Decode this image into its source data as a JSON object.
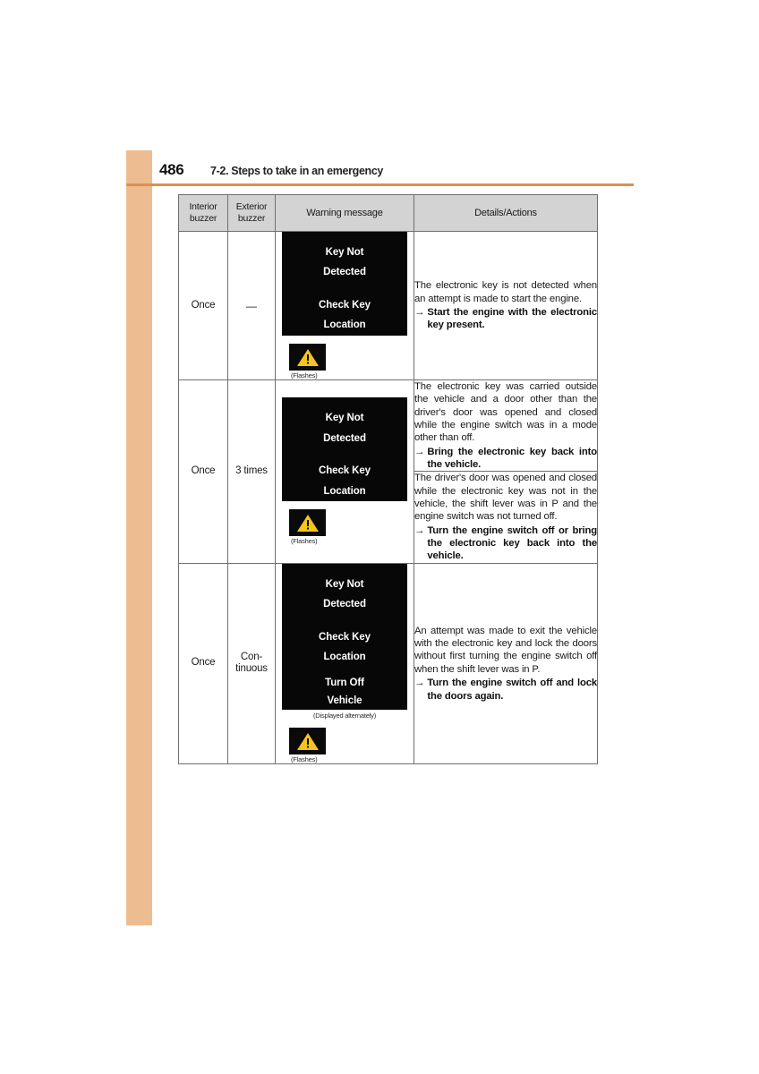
{
  "header": {
    "page_number": "486",
    "section_title": "7-2. Steps to take in an emergency"
  },
  "colors": {
    "side_tab": "#edbc91",
    "header_rule": "#de8f4f",
    "table_header_fill": "#d3d3d3",
    "display_panel_bg": "#070707",
    "warning_triangle": "#f5c518"
  },
  "table": {
    "columns": [
      {
        "line1": "Interior",
        "line2": "buzzer"
      },
      {
        "line1": "Exterior",
        "line2": "buzzer"
      },
      {
        "line1": "Warning message",
        "line2": ""
      },
      {
        "line1": "Details/Actions",
        "line2": ""
      }
    ],
    "rows": [
      {
        "interior_buzzer": "Once",
        "exterior_buzzer": "—",
        "message": {
          "panels": [
            {
              "lines": [
                "Key Not",
                "Detected",
                "Check Key",
                "Location"
              ],
              "gap_before_index": 2
            }
          ],
          "panel_note": "",
          "flash_caption": "(Flashes)",
          "flash_icon": "warning-triangle-icon"
        },
        "details": [
          {
            "body": "The electronic key is not detected when an attempt is made to start the engine.",
            "arrow": "→",
            "action": "Start the engine with the electronic key present."
          }
        ]
      },
      {
        "interior_buzzer": "Once",
        "exterior_buzzer": "3 times",
        "message": {
          "panels": [
            {
              "lines": [
                "Key Not",
                "Detected",
                "Check Key",
                "Location"
              ],
              "gap_before_index": 2
            }
          ],
          "panel_note": "",
          "flash_caption": "(Flashes)",
          "flash_icon": "warning-triangle-icon"
        },
        "details": [
          {
            "body": "The electronic key was carried outside the vehicle and a door other than the driver's door was opened and closed while the engine switch was in a mode other than off.",
            "arrow": "→",
            "action": "Bring the electronic key back into the vehicle."
          },
          {
            "body": "The driver's door was opened and closed while the electronic key was not in the vehicle, the shift lever was in P and the engine switch was not turned off.",
            "arrow": "→",
            "action": "Turn the engine switch off or bring the electronic key back into the vehicle."
          }
        ]
      },
      {
        "interior_buzzer": "Once",
        "exterior_buzzer": "Con-\ntinuous",
        "message": {
          "panels": [
            {
              "lines": [
                "Key Not",
                "Detected",
                "Check Key",
                "Location"
              ],
              "gap_before_index": 2
            },
            {
              "lines": [
                "Turn Off",
                "Vehicle"
              ],
              "gap_before_index": -1
            }
          ],
          "panel_note": "(Displayed alternately)",
          "flash_caption": "(Flashes)",
          "flash_icon": "warning-triangle-icon"
        },
        "details": [
          {
            "body": "An attempt was made to exit the vehicle with the electronic key and lock the doors without first turning the engine switch off when the shift lever was in P.",
            "arrow": "→",
            "action": "Turn the engine switch off and lock the doors again."
          }
        ]
      }
    ]
  }
}
